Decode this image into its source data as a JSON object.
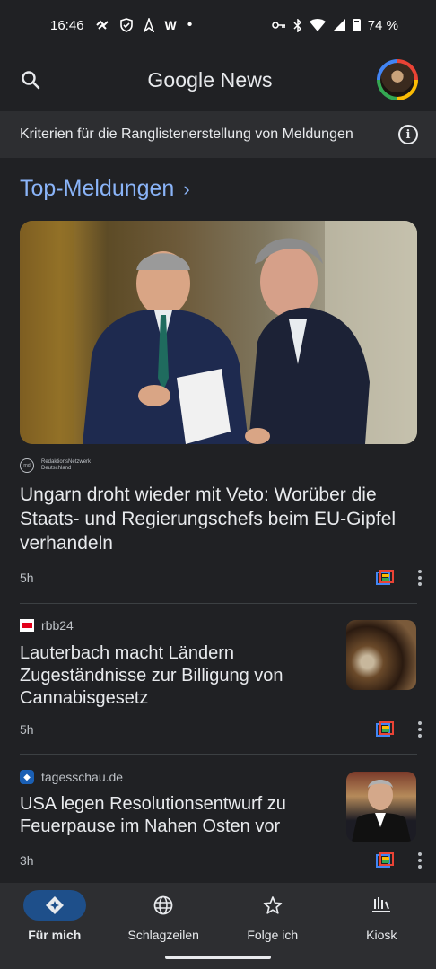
{
  "status_bar": {
    "time": "16:46",
    "battery": "74 %",
    "w_badge": "W",
    "dot": "•",
    "icons": [
      "wrist-icon",
      "shield-icon",
      "arrow-icon",
      "key-icon",
      "bluetooth-icon",
      "wifi-icon",
      "signal-icon",
      "battery-icon"
    ]
  },
  "app_bar": {
    "brand_google": "Google",
    "brand_news": "News"
  },
  "banner": {
    "text": "Kriterien für die Ranglistenerstellung von Meldungen",
    "info_glyph": "i"
  },
  "section": {
    "title": "Top-Meldungen",
    "chevron": "›"
  },
  "articles": [
    {
      "source_logo": "rnd",
      "source_line1": "RedaktionsNetzwerk",
      "source_line2": "Deutschland",
      "headline": "Ungarn droht wieder mit Veto: Worüber die Staats- und Regierungschefs beim EU-Gipfel verhandeln",
      "age": "5h"
    },
    {
      "source": "rbb24",
      "headline": "Lauterbach macht Ländern Zugeständnisse zur Billigung von Cannabisgesetz",
      "age": "5h"
    },
    {
      "source": "tagesschau.de",
      "headline": "USA legen Resolutionsentwurf zu Feuerpause im Nahen Osten vor",
      "age": "3h"
    }
  ],
  "bottom_nav": [
    {
      "label": "Für mich",
      "icon": "for-you-icon",
      "active": true
    },
    {
      "label": "Schlagzeilen",
      "icon": "globe-icon",
      "active": false
    },
    {
      "label": "Folge ich",
      "icon": "star-icon",
      "active": false
    },
    {
      "label": "Kiosk",
      "icon": "newsstand-icon",
      "active": false
    }
  ],
  "colors": {
    "background": "#202124",
    "surface": "#2d2e31",
    "accent": "#8ab4f8",
    "active_pill": "#1e4f8a"
  }
}
